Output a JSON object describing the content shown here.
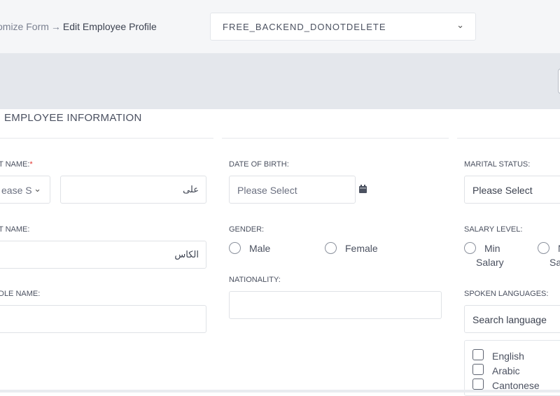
{
  "breadcrumb": {
    "prev": "omize Form",
    "arrow": "→",
    "current": "Edit Employee Profile"
  },
  "env_select": {
    "value": "FREE_BACKEND_DONOTDELETE",
    "chevron": "chevron-down-icon"
  },
  "section": {
    "title": "EMPLOYEE INFORMATION"
  },
  "fields": {
    "first_name": {
      "label": "T NAME:",
      "required_mark": "*",
      "prefix_placeholder": "ease S",
      "value": "على"
    },
    "last_name": {
      "label": "T NAME:",
      "value": "الكاس"
    },
    "middle_name": {
      "label": "DLE NAME:",
      "value": ""
    },
    "dob": {
      "label": "DATE OF BIRTH:",
      "placeholder": "Please Select",
      "icon": "calendar-icon"
    },
    "gender": {
      "label": "GENDER:",
      "options": [
        "Male",
        "Female"
      ]
    },
    "nationality": {
      "label": "NATIONALITY:",
      "value": ""
    },
    "marital": {
      "label": "MARITAL STATUS:",
      "placeholder": "Please Select"
    },
    "salary": {
      "label": "SALARY LEVEL:",
      "option1_line1": "Min",
      "option1_line2": "Salary",
      "option2_line1": "N",
      "option2_line2": "Sa"
    },
    "languages": {
      "label": "SPOKEN LANGUAGES:",
      "search_placeholder": "Search language",
      "items": [
        "English",
        "Arabic",
        "Cantonese"
      ]
    }
  },
  "colors": {
    "required": "#e0312c",
    "topbar": "#f5f6f8",
    "band": "#e4e7ec"
  }
}
